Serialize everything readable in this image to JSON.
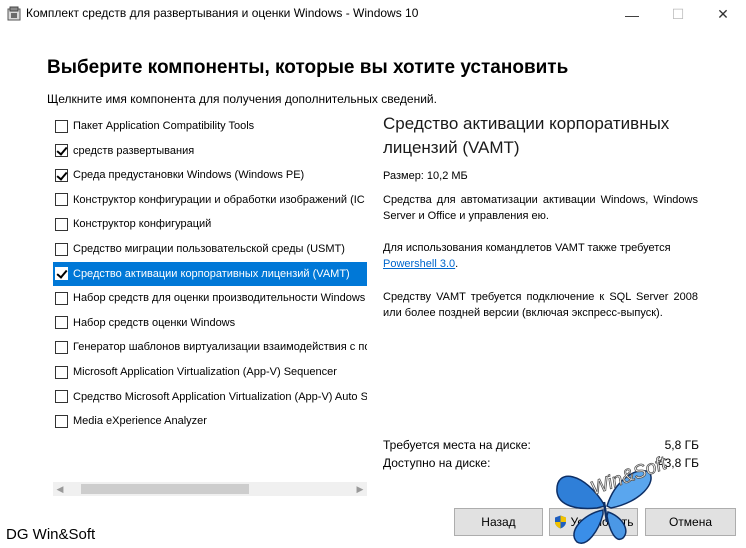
{
  "window": {
    "title": "Комплект средств для развертывания и оценки Windows - Windows 10",
    "controls": {
      "minimize": "—",
      "maximize": "☐",
      "close": "✕"
    }
  },
  "header": {
    "title": "Выберите компоненты, которые вы хотите установить",
    "subtitle": "Щелкните имя компонента для получения дополнительных сведений."
  },
  "features": [
    {
      "label": "Пакет Application Compatibility Tools",
      "checked": false,
      "selected": false
    },
    {
      "label": "средств развертывания",
      "checked": true,
      "selected": false
    },
    {
      "label": "Среда предустановки Windows (Windows PE)",
      "checked": true,
      "selected": false
    },
    {
      "label": "Конструктор конфигурации и обработки изображений (IC",
      "checked": false,
      "selected": false
    },
    {
      "label": "Конструктор конфигураций",
      "checked": false,
      "selected": false
    },
    {
      "label": "Средство миграции пользовательской среды (USMT)",
      "checked": false,
      "selected": false
    },
    {
      "label": "Средство активации корпоративных лицензий (VAMT)",
      "checked": true,
      "selected": true
    },
    {
      "label": "Набор средств для оценки производительности Windows",
      "checked": false,
      "selected": false
    },
    {
      "label": "Набор средств оценки Windows",
      "checked": false,
      "selected": false
    },
    {
      "label": "Генератор шаблонов виртуализации взаимодействия с по",
      "checked": false,
      "selected": false
    },
    {
      "label": "Microsoft Application Virtualization (App-V) Sequencer",
      "checked": false,
      "selected": false
    },
    {
      "label": "Средство Microsoft Application Virtualization (App-V) Auto S",
      "checked": false,
      "selected": false
    },
    {
      "label": "Media eXperience Analyzer",
      "checked": false,
      "selected": false
    }
  ],
  "detail": {
    "title": "Средство активации корпоративных лицензий (VAMT)",
    "size": "Размер:  10,2 МБ",
    "description": "Средства для автоматизации активации Windows, Windows Server и Office и управления ею.",
    "requirement_text": "Для использования командлетов VAMT также требуется",
    "requirement_link": "Powershell 3.0",
    "requirement_suffix": ".",
    "note": "Средству VAMT требуется подключение к SQL Server 2008 или более поздней версии (включая экспресс-выпуск)."
  },
  "disk": {
    "required_label": "Требуется места на диске:",
    "required_value": "5,8 ГБ",
    "available_label": "Доступно на диске:",
    "available_value": "43,8 ГБ"
  },
  "buttons": {
    "back": "Назад",
    "install": "Установить",
    "cancel": "Отмена"
  },
  "watermarks": {
    "left": "DG Win&Soft",
    "right": "Win&Soft"
  },
  "icons": {
    "app": "setup-package-icon",
    "uac": "uac-shield-icon",
    "checkmark": "checkmark-icon"
  },
  "colors": {
    "selection": "#0078d7",
    "link": "#0066cc",
    "button_bg": "#e1e1e1"
  }
}
